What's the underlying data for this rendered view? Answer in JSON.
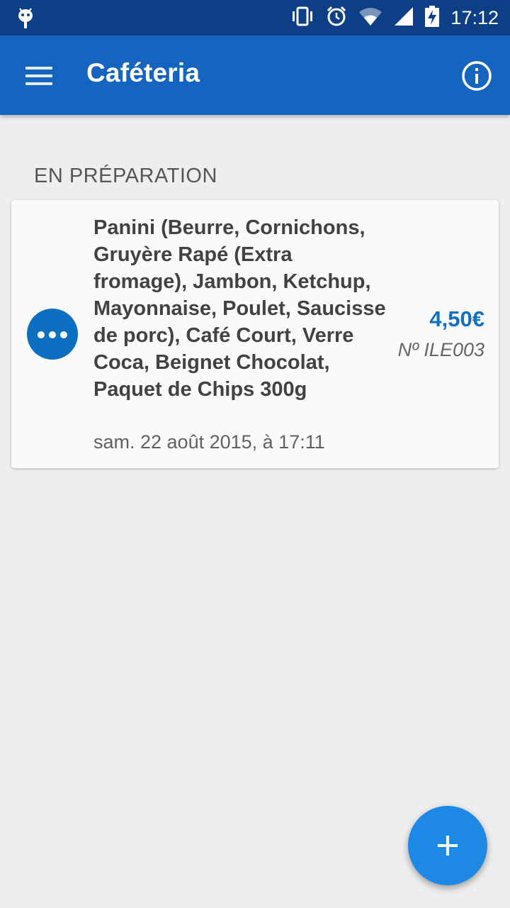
{
  "status_bar": {
    "time": "17:12",
    "icons": [
      "android-debug-icon",
      "vibrate-icon",
      "alarm-icon",
      "wifi-icon",
      "signal-icon",
      "battery-charging-icon"
    ]
  },
  "app_bar": {
    "title": "Caféteria",
    "menu_icon": "hamburger-menu-icon",
    "info_icon": "info-icon"
  },
  "section": {
    "title": "EN PRÉPARATION"
  },
  "orders": [
    {
      "items": "Panini (Beurre, Cornichons, Gruyère Rapé (Extra fromage), Jambon, Ketchup, Mayonnaise, Poulet, Saucisse de porc), Café Court, Verre Coca, Beignet Chocolat, Paquet de Chips 300g",
      "date": "sam. 22 août 2015, à 17:11",
      "price": "4,50€",
      "number": "Nº ILE003",
      "status_icon": "more-dots-icon"
    }
  ],
  "fab": {
    "icon": "add-icon"
  },
  "colors": {
    "status_bar": "#0d3f86",
    "app_bar": "#1565c0",
    "accent": "#1e88e5",
    "price": "#1270c2",
    "background": "#eeeeee"
  }
}
